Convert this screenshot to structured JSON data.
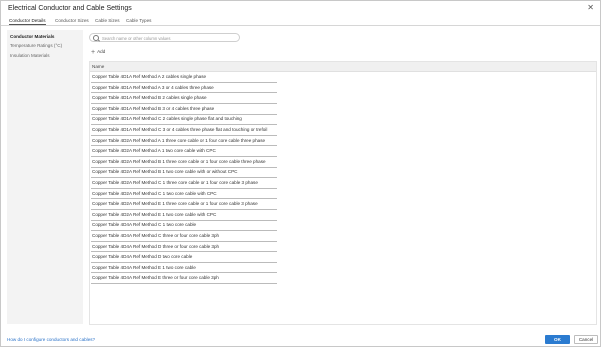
{
  "window": {
    "title": "Electrical Conductor and Cable Settings",
    "close_glyph": "✕"
  },
  "tabs": [
    {
      "label": "Conductor Details",
      "active": true
    },
    {
      "label": "Conductor Sizes",
      "active": false
    },
    {
      "label": "Cable Sizes",
      "active": false
    },
    {
      "label": "Cable Types",
      "active": false
    }
  ],
  "sidebar": {
    "items": [
      {
        "label": "Conductor Materials",
        "active": true
      },
      {
        "label": "Temperature Ratings (°C)",
        "active": false
      },
      {
        "label": "Insulation Materials",
        "active": false
      }
    ]
  },
  "search": {
    "placeholder": "Search name or other column values",
    "value": "",
    "icon": "search-icon"
  },
  "toolbar": {
    "add_label": "Add",
    "add_icon": "plus-icon"
  },
  "table": {
    "header": "Name",
    "rows": [
      "Copper Table 4D1A Ref Method A 2 cables single phase",
      "Copper Table 4D1A Ref Method A 3 or 4 cables three phase",
      "Copper Table 4D1A Ref Method B 2 cables single phase",
      "Copper Table 4D1A Ref Method B 3 or 4 cables three phase",
      "Copper Table 4D1A Ref Method C 2 cables single phase flat and touching",
      "Copper Table 4D1A Ref Method C 3 or 4 cables three phase flat and touching or trefoil",
      "Copper Table 4D2A Ref Method A 1 three core cable or 1 four core cable three phase",
      "Copper Table 4D2A Ref Method A 1 two core cable with CPC",
      "Copper Table 4D2A Ref Method B 1 three core cable or 1 four core cable three phase",
      "Copper Table 4D2A Ref Method B 1 two core cable with or without CPC",
      "Copper Table 4D2A Ref Method C 1 three core cable or 1 four core cable 3 phase",
      "Copper Table 4D2A Ref Method C 1 two core cable with CPC",
      "Copper Table 4D2A Ref Method E 1 three core cable or 1 four core cable 3 phase",
      "Copper Table 4D2A Ref Method E 1 two core cable with CPC",
      "Copper Table 4D4A Ref Method C 1 two core cable",
      "Copper Table 4D4A Ref Method C three or four core cable 3ph",
      "Copper Table 4D4A Ref Method D three or four core cable 3ph",
      "Copper Table 4D4A Ref Method D two core cable",
      "Copper Table 4D4A Ref Method E 1 two core cable",
      "Copper Table 4D4A Ref Method E three or four core cable 3ph"
    ]
  },
  "footer": {
    "help_link": "How do I configure conductors and cables?",
    "ok_label": "OK",
    "cancel_label": "Cancel"
  },
  "colors": {
    "primary_button": "#2b7bd0",
    "link": "#2a72c8",
    "sidebar_bg": "#f3f3f3"
  }
}
